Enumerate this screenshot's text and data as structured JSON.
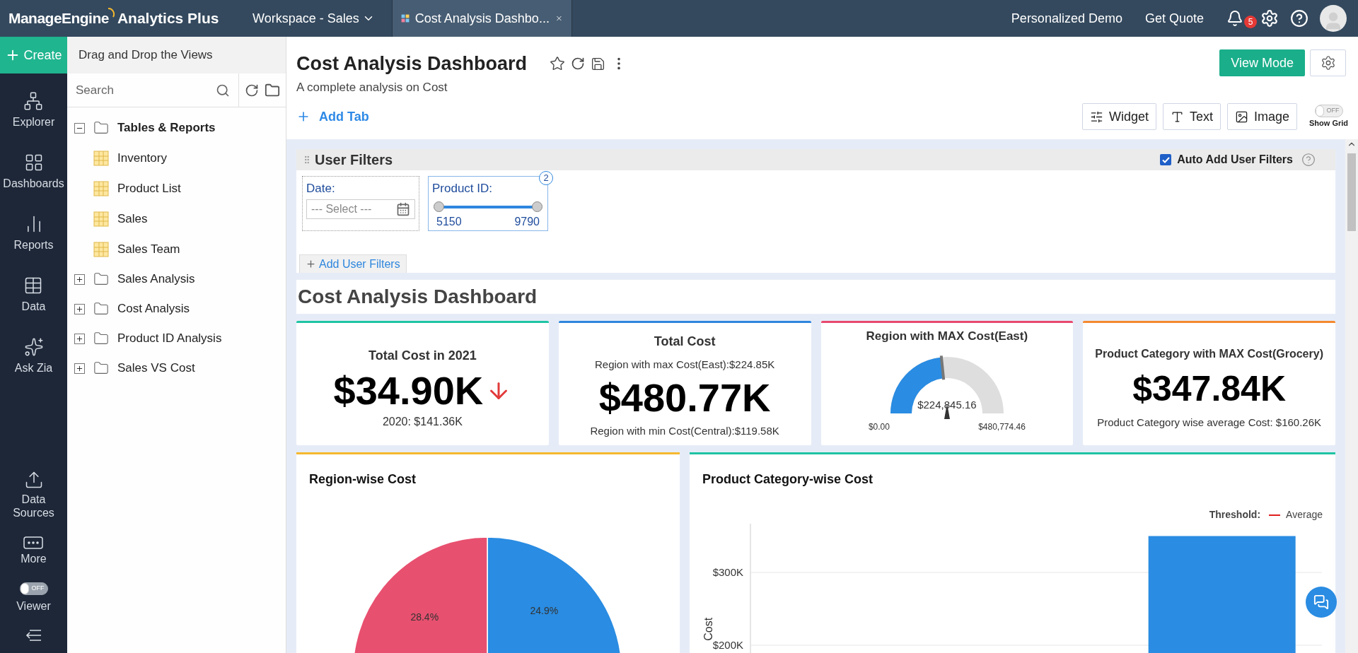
{
  "top_bar": {
    "brand": "ManageEngine",
    "product": "Analytics Plus",
    "workspace": "Workspace - Sales",
    "tabs": [
      {
        "label": "Cost Analysis Dashbo...",
        "selected": true
      }
    ],
    "links": [
      "Personalized Demo",
      "Get Quote"
    ],
    "notifications": "5"
  },
  "nav": {
    "create": "Create",
    "items": [
      "Explorer",
      "Dashboards",
      "Reports",
      "Data",
      "Ask Zia"
    ],
    "lower_items": [
      "Data Sources",
      "More"
    ],
    "viewer": {
      "label": "Viewer",
      "on": false,
      "state_text": "OFF"
    }
  },
  "explorer": {
    "header": "Drag and Drop the Views",
    "search": {
      "placeholder": "Search"
    },
    "tree": [
      {
        "label": "Tables & Reports",
        "expanded": true,
        "children": [
          {
            "label": "Inventory"
          },
          {
            "label": "Product List"
          },
          {
            "label": "Sales"
          },
          {
            "label": "Sales Team"
          }
        ]
      },
      {
        "label": "Sales Analysis",
        "expanded": false
      },
      {
        "label": "Cost Analysis",
        "expanded": false
      },
      {
        "label": "Product ID Analysis",
        "expanded": false
      },
      {
        "label": "Sales VS Cost",
        "expanded": false
      }
    ]
  },
  "dashboard": {
    "title": "Cost Analysis Dashboard",
    "subtitle": "A complete analysis on Cost",
    "view_mode": "View Mode",
    "add_tab": "Add Tab",
    "tools": [
      "Widget",
      "Text",
      "Image"
    ],
    "show_grid": {
      "label": "Show Grid",
      "on": false,
      "state_text": "OFF"
    }
  },
  "filters": {
    "title": "User Filters",
    "auto_add": {
      "label": "Auto Add User Filters",
      "checked": true
    },
    "items": [
      {
        "kind": "date",
        "label": "Date:",
        "placeholder": "--- Select ---"
      },
      {
        "kind": "range",
        "label": "Product ID:",
        "badge": "2",
        "min": "5150",
        "max": "9790",
        "level": 1
      }
    ],
    "add": "Add User Filters"
  },
  "canvas_title": "Cost Analysis Dashboard",
  "kpis": [
    {
      "kind": "trend",
      "title": "Total Cost in 2021",
      "value": "$34.90K",
      "falling": true,
      "note": "2020: $141.36K",
      "color": "#1fc4a4"
    },
    {
      "kind": "range",
      "title": "Total Cost",
      "above": "Region with max Cost(East):$224.85K",
      "value": "$480.77K",
      "below": "Region with min Cost(Central):$119.58K",
      "color": "#2e86de"
    },
    {
      "kind": "gauge",
      "title": "Region with MAX Cost(East)",
      "level": 0.468,
      "reading": "$224,845.16",
      "min": "$0.00",
      "max": "$480,774.46",
      "color": "#e8496f"
    },
    {
      "kind": "plain",
      "title": "Product Category with MAX Cost(Grocery)",
      "value": "$347.84K",
      "note": "Product Category wise average Cost: $160.26K",
      "color": "#f4892f"
    }
  ],
  "charts": [
    {
      "title": "Region-wise Cost",
      "color": "#f5b82e",
      "chart_data": {
        "type": "pie",
        "values": [
          24.9,
          28.4
        ],
        "value_labels": [
          "24.9%",
          "28.4%"
        ]
      }
    },
    {
      "title": "Product Category-wise Cost",
      "color": "#1fc4a4",
      "legend": {
        "label": "Threshold:",
        "item": "Average"
      },
      "chart_data": {
        "type": "bar",
        "ylabel": "Cost",
        "ylim": [
          0,
          367000
        ],
        "yticks": [
          {
            "value": 200000,
            "label": "$200K"
          },
          {
            "value": 300000,
            "label": "$300K"
          }
        ],
        "values": [
          null,
          null,
          350000
        ]
      }
    }
  ]
}
